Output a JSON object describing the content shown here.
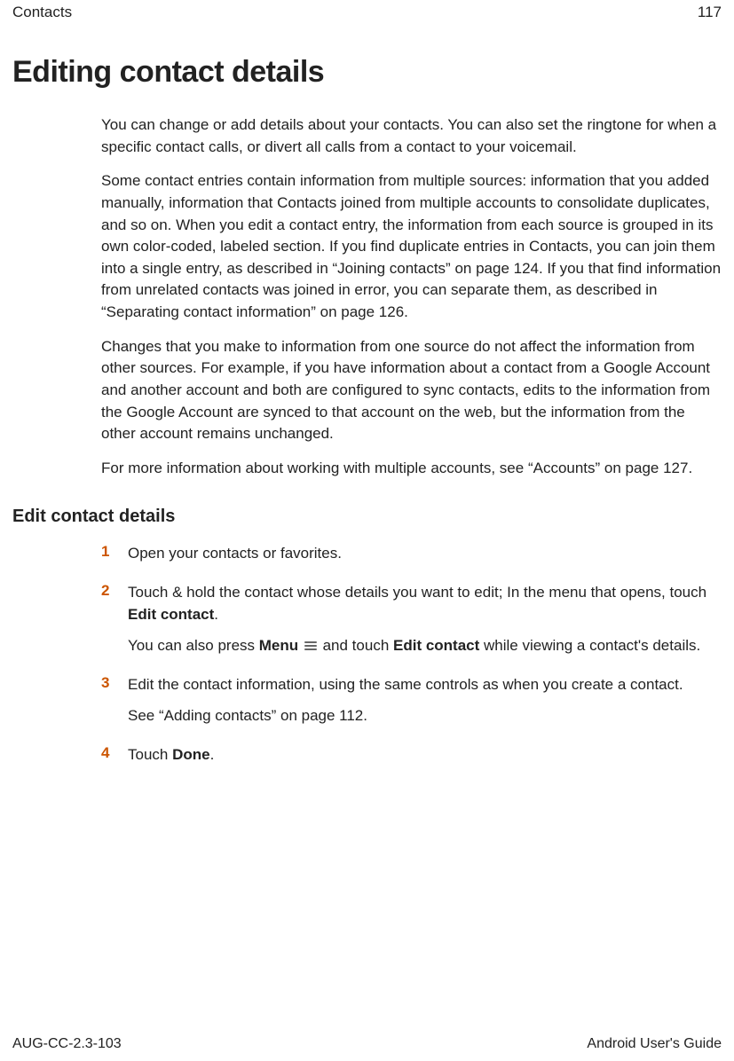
{
  "header": {
    "section": "Contacts",
    "page_number": "117"
  },
  "title": "Editing contact details",
  "intro": {
    "p1": "You can change or add details about your contacts. You can also set the ringtone for when a specific contact calls, or divert all calls from a contact to your voicemail.",
    "p2": "Some contact entries contain information from multiple sources: information that you added manually, information that Contacts joined from multiple accounts to consolidate duplicates, and so on. When you edit a contact entry, the information from each source is grouped in its own color-coded, labeled section. If you find duplicate entries in Contacts, you can join them into a single entry, as described in “Joining contacts” on page 124. If you that find information from unrelated contacts was joined in error, you can separate them, as described in “Separating contact information” on page 126.",
    "p3": "Changes that you make to information from one source do not affect the information from other sources. For example, if you have information about a contact from a Google Account and another account and both are configured to sync contacts, edits to the information from the Google Account are synced to that account on the web, but the information from the other account remains unchanged.",
    "p4": "For more information about working with multiple accounts, see “Accounts” on page 127."
  },
  "subheading": "Edit contact details",
  "steps": {
    "s1": {
      "num": "1",
      "p1": "Open your contacts or favorites."
    },
    "s2": {
      "num": "2",
      "p1_a": "Touch & hold the contact whose details you want to edit; In the menu that opens, touch ",
      "p1_b": "Edit contact",
      "p1_c": ".",
      "p2_a": "You can also press ",
      "p2_b": "Menu",
      "p2_c": " and touch ",
      "p2_d": "Edit contact",
      "p2_e": " while viewing a contact's details."
    },
    "s3": {
      "num": "3",
      "p1": "Edit the contact information, using the same controls as when you create a contact.",
      "p2": "See “Adding contacts” on page 112."
    },
    "s4": {
      "num": "4",
      "p1_a": "Touch ",
      "p1_b": "Done",
      "p1_c": "."
    }
  },
  "footer": {
    "doc_id": "AUG-CC-2.3-103",
    "guide_name": "Android User's Guide"
  }
}
